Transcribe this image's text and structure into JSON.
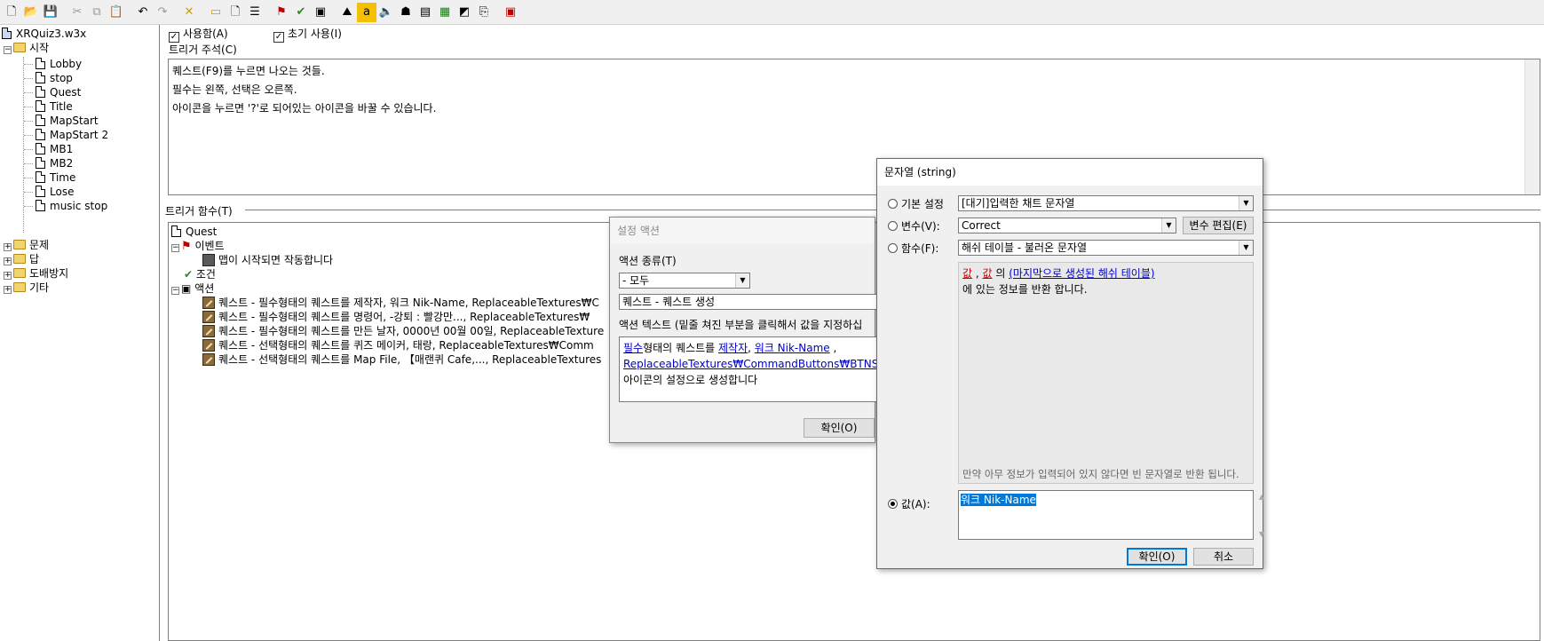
{
  "toolbar": {
    "icons": [
      "new-icon",
      "open-icon",
      "save-icon",
      "cut-icon",
      "copy-icon",
      "paste-icon",
      "undo-icon",
      "redo-icon",
      "delete-icon",
      "new-category-icon",
      "new-trigger-icon",
      "new-comment-icon",
      "new-event-icon",
      "new-condition-icon",
      "new-action-icon",
      "terrain-editor-icon",
      "unit-editor-icon",
      "sound-editor-icon",
      "object-editor-icon",
      "campaign-editor-icon",
      "ai-editor-icon",
      "object-manager-icon",
      "import-manager-icon",
      "test-map-icon"
    ]
  },
  "tree": {
    "root": "XRQuiz3.w3x",
    "folder_start": "시작",
    "items": [
      "Lobby",
      "stop",
      "Quest",
      "Title",
      "MapStart",
      "MapStart 2",
      "MB1",
      "MB2",
      "Time",
      "Lose",
      "music stop"
    ],
    "folders": [
      "문제",
      "답",
      "도배방지",
      "기타"
    ]
  },
  "trigger": {
    "enabled_label": "사용함(A)",
    "initially_on_label": "초기 사용(I)",
    "comment_label": "트리거 주석(C)",
    "comment_lines": [
      "퀘스트(F9)를 누르면 나오는 것들.",
      "필수는 왼쪽,  선택은 오른쪽.",
      "아이콘을 누르면 '?'로 되어있는 아이콘을 바꿀 수 있습니다."
    ],
    "functions_label": "트리거 함수(T)"
  },
  "functions": {
    "name": "Quest",
    "events_label": "이벤트",
    "event_item": "맵이 시작되면 작동합니다",
    "conditions_label": "조건",
    "actions_label": "액션",
    "actions": [
      "퀘스트 - 필수형태의 퀘스트를 제작자, 워크 Nik-Name, ReplaceableTextures₩C",
      "퀘스트 - 필수형태의 퀘스트를 명령어, -강퇴 : 빨강만..., ReplaceableTextures₩",
      "퀘스트 - 필수형태의 퀘스트를 만든 날자, 0000년 00월 00일, ReplaceableTexture",
      "퀘스트 - 선택형태의 퀘스트를 퀴즈 메이커, 태랑, ReplaceableTextures₩Comm",
      "퀘스트 - 선택형태의 퀘스트를 Map File,  【매랜퀴 Cafe,..., ReplaceableTextures"
    ]
  },
  "config_dialog": {
    "title": "설정 액션",
    "action_type_label": "액션 종류(T)",
    "action_type_value": "- 모두",
    "action_value": "퀘스트 - 퀘스트 생성",
    "action_text_label": "액션 텍스트 (밑줄 쳐진 부분을 클릭해서 값을 지정하십",
    "text_part1": "필수",
    "text_part2": "형태의 퀘스트를 ",
    "text_link1": "제작자",
    "text_sep1": ",  ",
    "text_link2": "워크 Nik-Name",
    "text_sep2": " ,",
    "text_link3": "ReplaceableTextures₩CommandButtons₩BTNSel",
    "text_end": "아이콘의 설정으로 생성합니다",
    "ok_label": "확인(O)"
  },
  "string_dialog": {
    "title": "문자열 (string)",
    "preset_label": "기본 설정",
    "preset_value": "[대기]입력한 채트 문자열",
    "variable_label": "변수(V):",
    "variable_value": "Correct",
    "edit_var_label": "변수 편집(E)",
    "function_label": "함수(F):",
    "function_value": "해쉬 테이블 - 불러온 문자열",
    "desc_val1": "값",
    "desc_comma": " , ",
    "desc_val2": "값",
    "desc_of": "  의  ",
    "desc_table": "(마지막으로 생성된 해쉬 테이블)",
    "desc_line2": "  에 있는 정보를 반환 합니다.",
    "desc_note": "만약 아무 정보가 입력되어 있지 않다면 빈 문자열로 반환 됩니다.",
    "value_label": "값(A):",
    "value_text": "워크 Nik-Name",
    "ok_label": "확인(O)",
    "cancel_label": "취소"
  }
}
